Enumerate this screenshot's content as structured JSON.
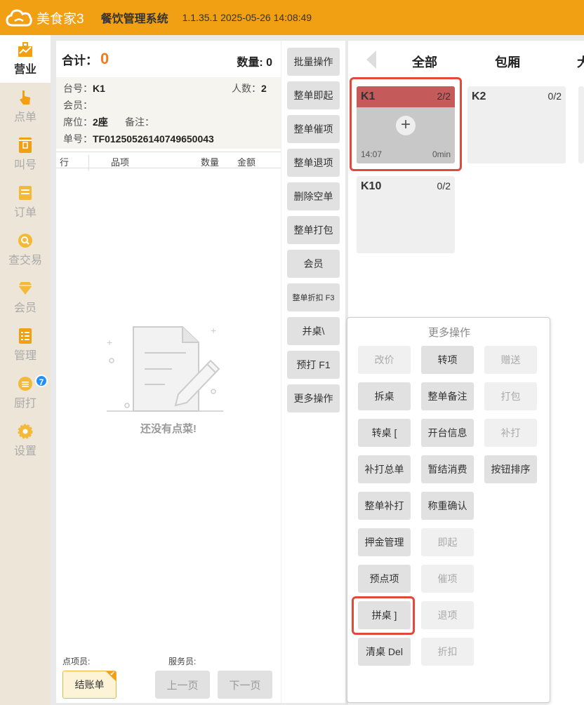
{
  "header": {
    "logo_text": "美食家3",
    "system_title": "餐饮管理系统",
    "version": "1.1.35.1 2025-05-26 14:08:49"
  },
  "nav": [
    {
      "label": "营业",
      "icon": "store-icon",
      "active": true
    },
    {
      "label": "点单",
      "icon": "hand-tap-icon"
    },
    {
      "label": "叫号",
      "icon": "ticket-icon"
    },
    {
      "label": "订单",
      "icon": "receipt-icon"
    },
    {
      "label": "查交易",
      "icon": "search-icon"
    },
    {
      "label": "会员",
      "icon": "diamond-icon"
    },
    {
      "label": "管理",
      "icon": "checklist-icon"
    },
    {
      "label": "厨打",
      "icon": "printer-icon",
      "badge": "7"
    },
    {
      "label": "设置",
      "icon": "gear-icon"
    }
  ],
  "order": {
    "total_label": "合计：",
    "total_value": "0",
    "qty_label": "数量:  0",
    "table_label": "台号：",
    "table_value": "K1",
    "people_label": "人数：",
    "people_value": "2",
    "member_label": "会员：",
    "seat_label": "席位：",
    "seat_value": "2座",
    "note_label": "备注：",
    "order_no_label": "单号：",
    "order_no_value": "TF0125052614074965004​3",
    "columns": [
      "行",
      "品项",
      "数量",
      "金额"
    ],
    "empty_text": "还没有点菜!",
    "orderer_label": "点项员:",
    "waiter_label": "服务员:",
    "checkout_label": "结账单",
    "prev_page": "上一页",
    "next_page": "下一页"
  },
  "actions": [
    "批量操作",
    "整单即起",
    "整单催项",
    "整单退项",
    "删除空单",
    "整单打包",
    "会员",
    "整单折扣 F3",
    "并桌\\",
    "预打 F1",
    "更多操作"
  ],
  "tabs": [
    "全部",
    "包厢",
    "大"
  ],
  "tables": [
    {
      "name": "K1",
      "seats": "2/2",
      "time": "14:07",
      "duration": "0min",
      "occupied": true
    },
    {
      "name": "K2",
      "seats": "0/2",
      "occupied": false
    },
    {
      "name": "K10",
      "seats": "0/2",
      "occupied": false
    }
  ],
  "more_panel": {
    "title": "更多操作",
    "buttons": [
      {
        "label": "改价",
        "enabled": false
      },
      {
        "label": "转项",
        "enabled": true
      },
      {
        "label": "赠送",
        "enabled": false
      },
      {
        "label": "拆桌",
        "enabled": true
      },
      {
        "label": "整单备注",
        "enabled": true
      },
      {
        "label": "打包",
        "enabled": false
      },
      {
        "label": "转桌 [",
        "enabled": true
      },
      {
        "label": "开台信息",
        "enabled": true
      },
      {
        "label": "补打",
        "enabled": false
      },
      {
        "label": "补打总单",
        "enabled": true
      },
      {
        "label": "暂结消费",
        "enabled": true
      },
      {
        "label": "按钮排序",
        "enabled": true
      },
      {
        "label": "整单补打",
        "enabled": true
      },
      {
        "label": "称重确认",
        "enabled": true
      },
      {
        "label": "押金管理",
        "enabled": true
      },
      {
        "label": "即起",
        "enabled": false
      },
      {
        "label": "预点项",
        "enabled": true
      },
      {
        "label": "催项",
        "enabled": false
      },
      {
        "label": "拼桌 ]",
        "enabled": true
      },
      {
        "label": "退项",
        "enabled": false
      },
      {
        "label": "清桌 Del",
        "enabled": true
      },
      {
        "label": "折扣",
        "enabled": false
      }
    ]
  },
  "colors": {
    "brand": "#f0a012",
    "accent": "#f07c20",
    "occupied": "#c45a5a",
    "highlight": "#e04a3a",
    "badge": "#1e90ff"
  }
}
